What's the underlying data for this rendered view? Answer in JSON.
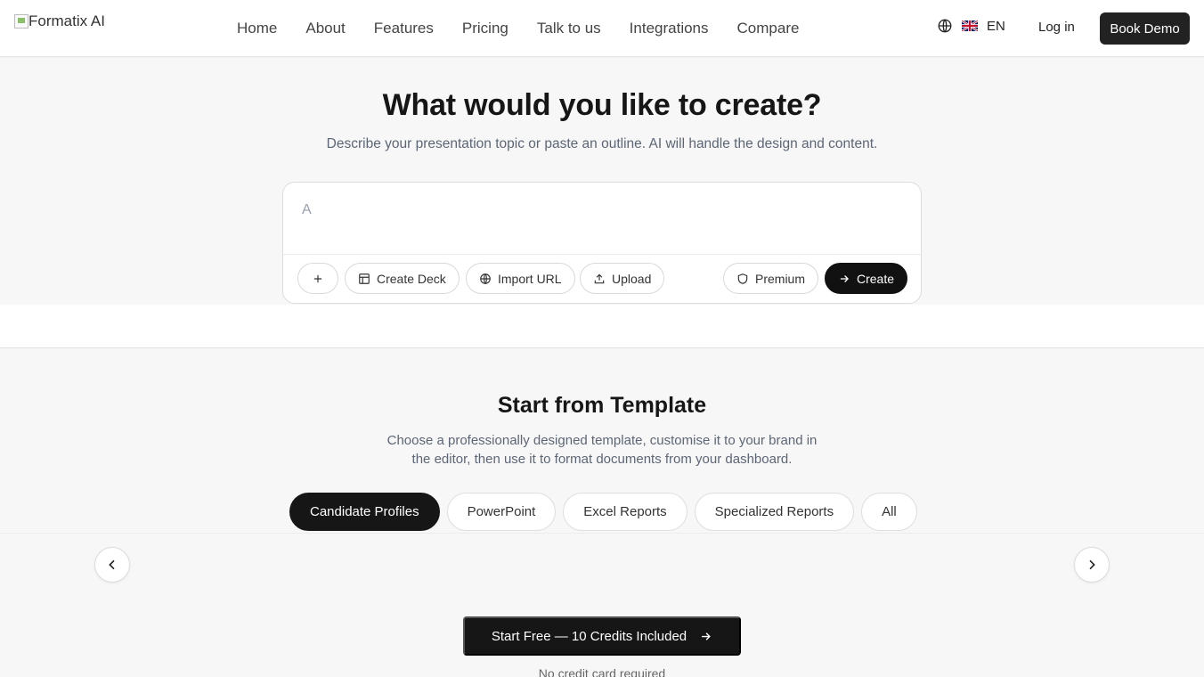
{
  "header": {
    "logo_alt": "Formatix AI",
    "nav": [
      "Home",
      "About",
      "Features",
      "Pricing",
      "Talk to us",
      "Integrations",
      "Compare"
    ],
    "language": "EN",
    "login": "Log in",
    "book_demo": "Book Demo"
  },
  "hero": {
    "title": "What would you like to create?",
    "subtitle": "Describe your presentation topic or paste an outline. AI will handle the design and content.",
    "input_value": "A",
    "buttons": {
      "create_deck": "Create Deck",
      "import_url": "Import URL",
      "upload": "Upload",
      "premium": "Premium",
      "create": "Create"
    }
  },
  "templates": {
    "title": "Start from Template",
    "description": "Choose a professionally designed template, customise it to your brand in the editor, then use it to format documents from your dashboard.",
    "tabs": [
      "Candidate Profiles",
      "PowerPoint",
      "Excel Reports",
      "Specialized Reports",
      "All"
    ],
    "active_tab": "Candidate Profiles"
  },
  "cta": {
    "label": "Start Free — 10 Credits Included",
    "note": "No credit card required"
  }
}
